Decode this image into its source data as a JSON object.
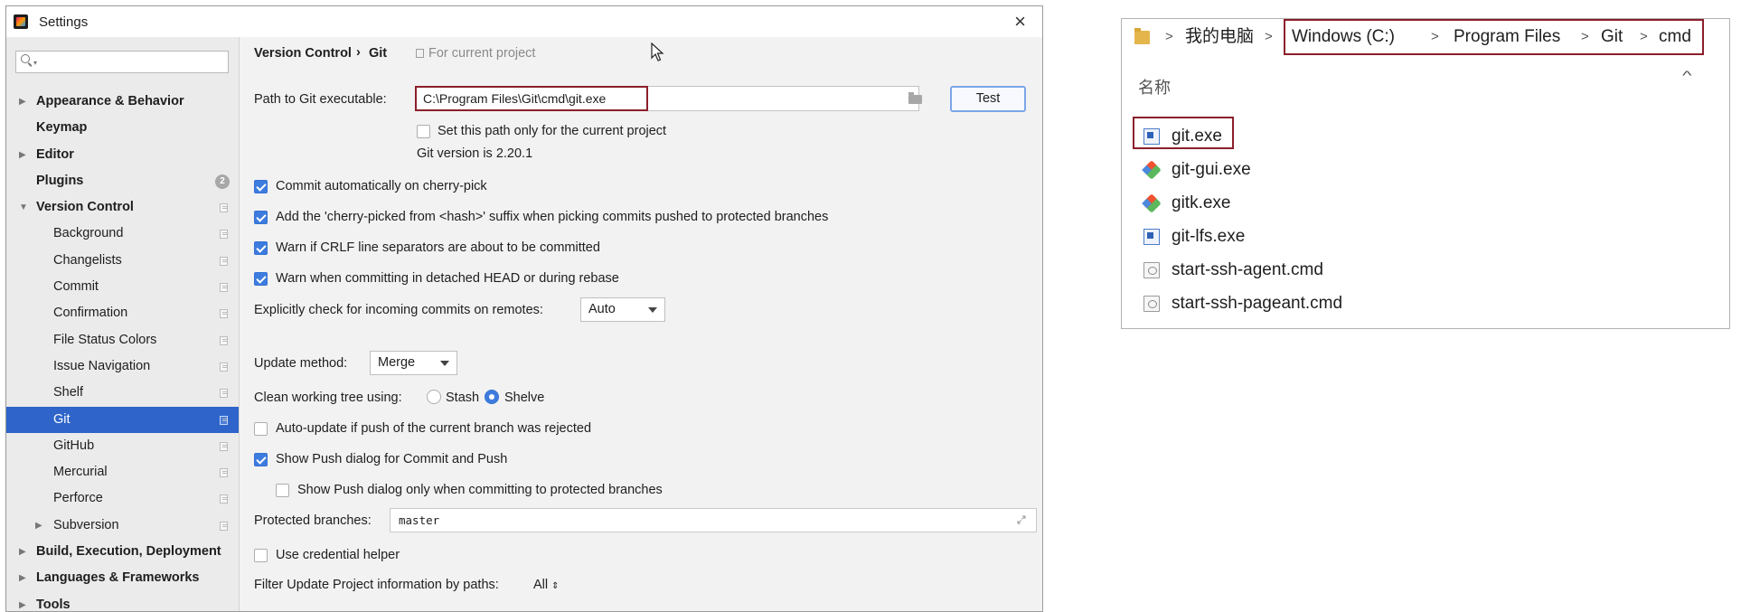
{
  "settings": {
    "window_title": "Settings",
    "search_placeholder": "",
    "tree": [
      {
        "label": "Appearance & Behavior",
        "level": 0,
        "bold": true,
        "arrow": "right",
        "badge": "",
        "icon": false,
        "selected": false
      },
      {
        "label": "Keymap",
        "level": 0,
        "bold": true,
        "arrow": "",
        "badge": "",
        "icon": false,
        "selected": false
      },
      {
        "label": "Editor",
        "level": 0,
        "bold": true,
        "arrow": "right",
        "badge": "",
        "icon": false,
        "selected": false
      },
      {
        "label": "Plugins",
        "level": 0,
        "bold": true,
        "arrow": "",
        "badge": "2",
        "icon": false,
        "selected": false
      },
      {
        "label": "Version Control",
        "level": 0,
        "bold": true,
        "arrow": "down",
        "badge": "",
        "icon": true,
        "selected": false
      },
      {
        "label": "Background",
        "level": 1,
        "bold": false,
        "arrow": "",
        "badge": "",
        "icon": true,
        "selected": false
      },
      {
        "label": "Changelists",
        "level": 1,
        "bold": false,
        "arrow": "",
        "badge": "",
        "icon": true,
        "selected": false
      },
      {
        "label": "Commit",
        "level": 1,
        "bold": false,
        "arrow": "",
        "badge": "",
        "icon": true,
        "selected": false
      },
      {
        "label": "Confirmation",
        "level": 1,
        "bold": false,
        "arrow": "",
        "badge": "",
        "icon": true,
        "selected": false
      },
      {
        "label": "File Status Colors",
        "level": 1,
        "bold": false,
        "arrow": "",
        "badge": "",
        "icon": true,
        "selected": false
      },
      {
        "label": "Issue Navigation",
        "level": 1,
        "bold": false,
        "arrow": "",
        "badge": "",
        "icon": true,
        "selected": false
      },
      {
        "label": "Shelf",
        "level": 1,
        "bold": false,
        "arrow": "",
        "badge": "",
        "icon": true,
        "selected": false
      },
      {
        "label": "Git",
        "level": 1,
        "bold": false,
        "arrow": "",
        "badge": "",
        "icon": true,
        "selected": true
      },
      {
        "label": "GitHub",
        "level": 1,
        "bold": false,
        "arrow": "",
        "badge": "",
        "icon": true,
        "selected": false
      },
      {
        "label": "Mercurial",
        "level": 1,
        "bold": false,
        "arrow": "",
        "badge": "",
        "icon": true,
        "selected": false
      },
      {
        "label": "Perforce",
        "level": 1,
        "bold": false,
        "arrow": "",
        "badge": "",
        "icon": true,
        "selected": false
      },
      {
        "label": "Subversion",
        "level": 1,
        "bold": false,
        "arrow": "right",
        "badge": "",
        "icon": true,
        "selected": false
      },
      {
        "label": "Build, Execution, Deployment",
        "level": 0,
        "bold": true,
        "arrow": "right",
        "badge": "",
        "icon": false,
        "selected": false
      },
      {
        "label": "Languages & Frameworks",
        "level": 0,
        "bold": true,
        "arrow": "right",
        "badge": "",
        "icon": false,
        "selected": false
      },
      {
        "label": "Tools",
        "level": 0,
        "bold": true,
        "arrow": "right",
        "badge": "",
        "icon": false,
        "selected": false
      }
    ],
    "breadcrumb": {
      "parent": "Version Control",
      "sep": "›",
      "current": "Git",
      "scope": "For current project"
    },
    "path": {
      "label": "Path to Git executable:",
      "value": "C:\\Program Files\\Git\\cmd\\git.exe",
      "test_label": "Test"
    },
    "set_path_only": {
      "label": "Set this path only for the current project",
      "checked": false
    },
    "git_version": "Git version is 2.20.1",
    "options": [
      {
        "label": "Commit automatically on cherry-pick",
        "checked": true
      },
      {
        "label": "Add the 'cherry-picked from <hash>' suffix when picking commits pushed to protected branches",
        "checked": true
      },
      {
        "label": "Warn if CRLF line separators are about to be committed",
        "checked": true
      },
      {
        "label": "Warn when committing in detached HEAD or during rebase",
        "checked": true
      }
    ],
    "incoming": {
      "label": "Explicitly check for incoming commits on remotes:",
      "value": "Auto"
    },
    "update_method": {
      "label": "Update method:",
      "value": "Merge"
    },
    "clean_tree": {
      "label": "Clean working tree using:",
      "stash": "Stash",
      "shelve": "Shelve",
      "selected": "shelve"
    },
    "auto_update": {
      "label": "Auto-update if push of the current branch was rejected",
      "checked": false
    },
    "show_push": {
      "label": "Show Push dialog for Commit and Push",
      "checked": true
    },
    "show_push_protected": {
      "label": "Show Push dialog only when committing to protected branches",
      "checked": false
    },
    "protected_branches": {
      "label": "Protected branches:",
      "value": "master"
    },
    "credential_helper": {
      "label": "Use credential helper",
      "checked": false
    },
    "filter": {
      "label": "Filter Update Project information by paths:",
      "value": "All"
    }
  },
  "explorer": {
    "breadcrumb": [
      "我的电脑",
      "Windows (C:)",
      "Program Files",
      "Git",
      "cmd"
    ],
    "column_header": "名称",
    "files": [
      {
        "name": "git.exe",
        "icon": "app-icon"
      },
      {
        "name": "git-gui.exe",
        "icon": "git-logo-icon"
      },
      {
        "name": "gitk.exe",
        "icon": "git-logo-icon"
      },
      {
        "name": "git-lfs.exe",
        "icon": "app-icon"
      },
      {
        "name": "start-ssh-agent.cmd",
        "icon": "cmd-file-icon"
      },
      {
        "name": "start-ssh-pageant.cmd",
        "icon": "cmd-file-icon"
      }
    ]
  },
  "colors": {
    "highlight": "#8b1f2b",
    "selection": "#2f65ca",
    "accent": "#3d7cde"
  }
}
